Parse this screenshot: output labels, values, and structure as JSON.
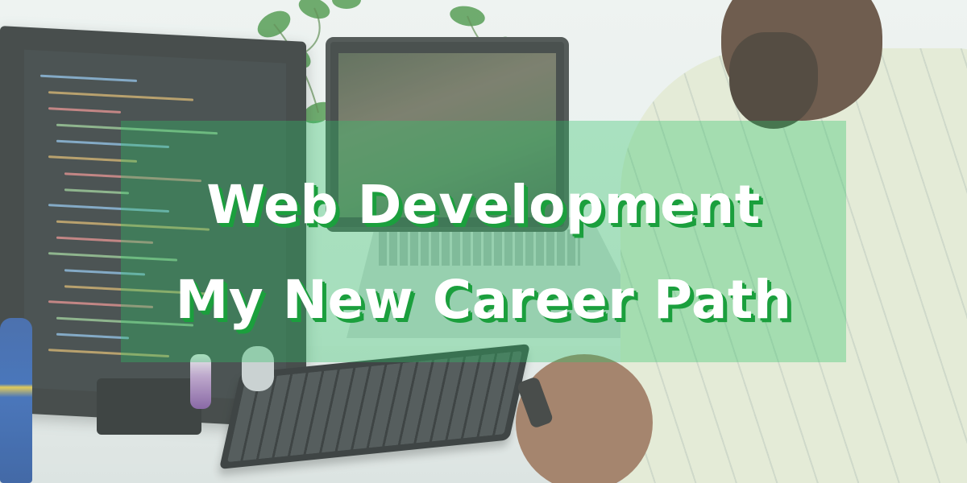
{
  "banner": {
    "line1": "Web Development",
    "line2": "My New Career Path"
  },
  "colors": {
    "overlay_green": "#2fc467",
    "text_white": "#ffffff",
    "text_shadow_green": "#1b9f3d"
  },
  "scene": {
    "objects": [
      "monitor",
      "laptop",
      "keyboard",
      "person",
      "plant",
      "toy-figures"
    ]
  }
}
